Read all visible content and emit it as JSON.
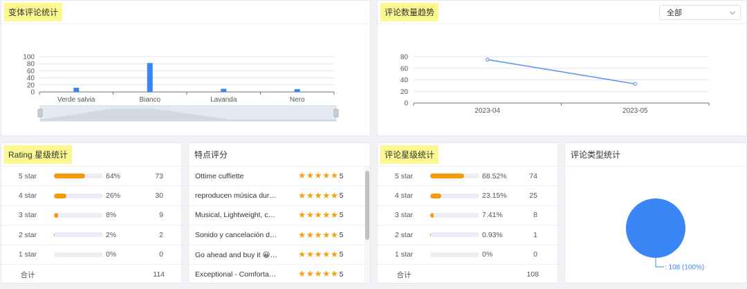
{
  "variant_card": {
    "title": "变体评论统计",
    "chart_data": {
      "type": "bar",
      "categories": [
        "Verde salvia",
        "Bianco",
        "Lavanda",
        "Nero"
      ],
      "values": [
        12,
        82,
        9,
        8
      ],
      "yticks": [
        "0",
        "20",
        "40",
        "60",
        "80",
        "100"
      ],
      "ylim": [
        0,
        100
      ],
      "grid": true,
      "bar_color": "#3b86f6"
    }
  },
  "trend_card": {
    "title": "评论数量趋势",
    "filter_value": "全部",
    "chart_data": {
      "type": "line",
      "x": [
        "2023-04",
        "2023-05"
      ],
      "values": [
        75,
        33
      ],
      "yticks": [
        "0",
        "20",
        "40",
        "60",
        "80"
      ],
      "ylim": [
        0,
        80
      ],
      "grid": true,
      "line_color": "#5b96f7"
    }
  },
  "rating_card": {
    "title": "Rating 星级统计",
    "rows": [
      {
        "label": "5 star",
        "pct": "64%",
        "count": "73",
        "fill": 0.64
      },
      {
        "label": "4 star",
        "pct": "26%",
        "count": "30",
        "fill": 0.26
      },
      {
        "label": "3 star",
        "pct": "8%",
        "count": "9",
        "fill": 0.08
      },
      {
        "label": "2 star",
        "pct": "2%",
        "count": "2",
        "fill": 0.02
      },
      {
        "label": "1 star",
        "pct": "0%",
        "count": "0",
        "fill": 0
      }
    ],
    "total_label": "合计",
    "total_count": "114"
  },
  "feature_card": {
    "title": "特点评分",
    "rows": [
      {
        "text": "Ottime cuffiette",
        "score": "5"
      },
      {
        "text": "reproducen música durant…",
        "score": "5"
      },
      {
        "text": "Musical, Lightweight, com…",
        "score": "5"
      },
      {
        "text": "Sonido y cancelación de r…",
        "score": "5"
      },
      {
        "text": "Go ahead and buy it 😀👍",
        "score": "5"
      },
      {
        "text": "Exceptional - Comfortable…",
        "score": "5"
      }
    ]
  },
  "review_star_card": {
    "title": "评论星级统计",
    "rows": [
      {
        "label": "5 star",
        "pct": "68.52%",
        "count": "74",
        "fill": 0.6852
      },
      {
        "label": "4 star",
        "pct": "23.15%",
        "count": "25",
        "fill": 0.2315
      },
      {
        "label": "3 star",
        "pct": "7.41%",
        "count": "8",
        "fill": 0.0741
      },
      {
        "label": "2 star",
        "pct": "0.93%",
        "count": "1",
        "fill": 0.0093
      },
      {
        "label": "1 star",
        "pct": "0%",
        "count": "0",
        "fill": 0
      }
    ],
    "total_label": "合计",
    "total_count": "108"
  },
  "type_card": {
    "title": "评论类型统计",
    "chart_data": {
      "type": "pie",
      "slices": [
        {
          "label": ": 108 (100%)",
          "value": 108,
          "percent": 100
        }
      ],
      "color": "#3a86f7"
    }
  }
}
